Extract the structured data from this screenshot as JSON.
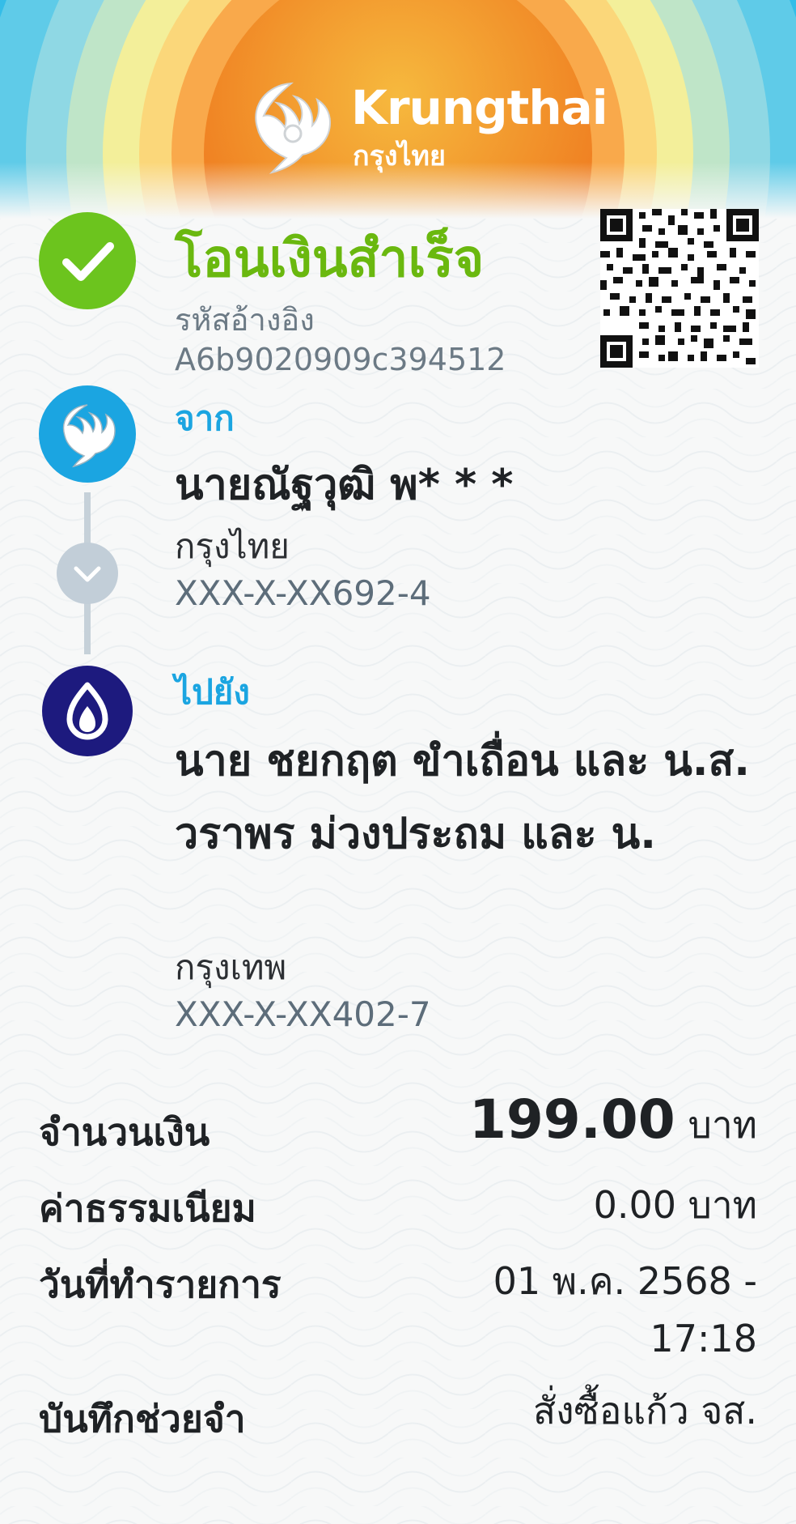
{
  "header": {
    "brand_name": "Krungthai",
    "brand_thai": "กรุงไทย",
    "colors": {
      "orange": "#f08a24",
      "blue": "#2fbde8",
      "green": "#6cc41e"
    }
  },
  "status": {
    "title": "โอนเงินสำเร็จ",
    "ref_label": "รหัสอ้างอิง",
    "ref_value": "A6b9020909c394512",
    "icon": "check-icon"
  },
  "from": {
    "label": "จาก",
    "name": "นายณัฐวุฒิ พ* * *",
    "bank": "กรุงไทย",
    "account": "XXX-X-XX692-4",
    "icon": "krungthai-bird-icon"
  },
  "to": {
    "label": "ไปยัง",
    "name": "นาย ชยกฤต ขำเถื่อน และ น.ส. วราพร ม่วงประถม และ น.",
    "bank": "กรุงเทพ",
    "account": "XXX-X-XX402-7",
    "icon": "bangkok-bank-lotus-icon"
  },
  "summary": {
    "amount_label": "จำนวนเงิน",
    "amount_value": "199.00",
    "amount_unit": "บาท",
    "fee_label": "ค่าธรรมเนียม",
    "fee_value": "0.00 บาท",
    "date_label": "วันที่ทำรายการ",
    "date_value": "01 พ.ค. 2568 -",
    "time_value": "17:18",
    "memo_label": "บันทึกช่วยจำ",
    "memo_value": "สั่งซื้อแก้ว จส."
  }
}
